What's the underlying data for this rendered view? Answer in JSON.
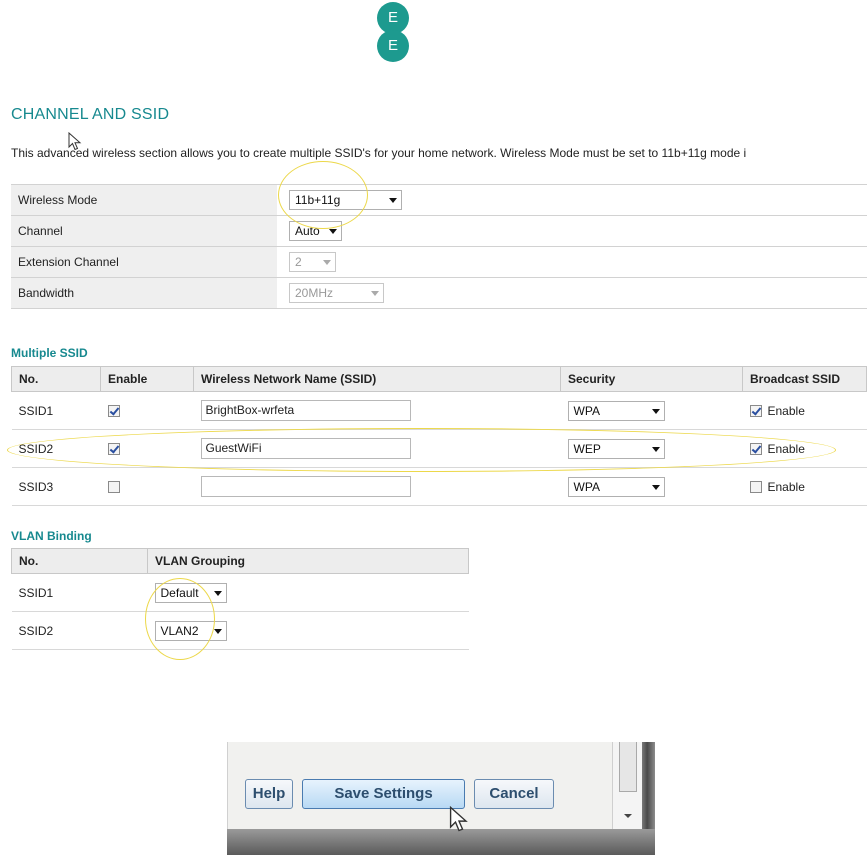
{
  "brand": {
    "logo_top": "E",
    "logo_bottom": "E",
    "color": "#1d9a8f"
  },
  "page": {
    "title": "CHANNEL AND SSID",
    "intro": "This advanced wireless section allows you to create multiple SSID's for your home network. Wireless Mode must be set to 11b+11g mode i"
  },
  "settings": [
    {
      "label": "Wireless Mode",
      "value": "11b+11g",
      "disabled": false
    },
    {
      "label": "Channel",
      "value": "Auto",
      "disabled": false
    },
    {
      "label": "Extension Channel",
      "value": "2",
      "disabled": true
    },
    {
      "label": "Bandwidth",
      "value": "20MHz",
      "disabled": true
    }
  ],
  "multiple_ssid": {
    "title": "Multiple SSID",
    "headers": [
      "No.",
      "Enable",
      "Wireless Network Name (SSID)",
      "Security",
      "Broadcast SSID"
    ],
    "rows": [
      {
        "no": "SSID1",
        "enabled": true,
        "name": "BrightBox-wrfeta",
        "security": "WPA",
        "broadcast": true,
        "broadcast_label": "Enable"
      },
      {
        "no": "SSID2",
        "enabled": true,
        "name": "GuestWiFi",
        "security": "WEP",
        "broadcast": true,
        "broadcast_label": "Enable"
      },
      {
        "no": "SSID3",
        "enabled": false,
        "name": "",
        "security": "WPA",
        "broadcast": false,
        "broadcast_label": "Enable"
      }
    ]
  },
  "vlan_binding": {
    "title": "VLAN Binding",
    "headers": [
      "No.",
      "VLAN Grouping"
    ],
    "rows": [
      {
        "no": "SSID1",
        "grouping": "Default"
      },
      {
        "no": "SSID2",
        "grouping": "VLAN2"
      }
    ]
  },
  "buttons": {
    "help": "Help",
    "save": "Save Settings",
    "cancel": "Cancel"
  },
  "colors": {
    "accent": "#17898f",
    "highlight": "#ecd84a"
  }
}
